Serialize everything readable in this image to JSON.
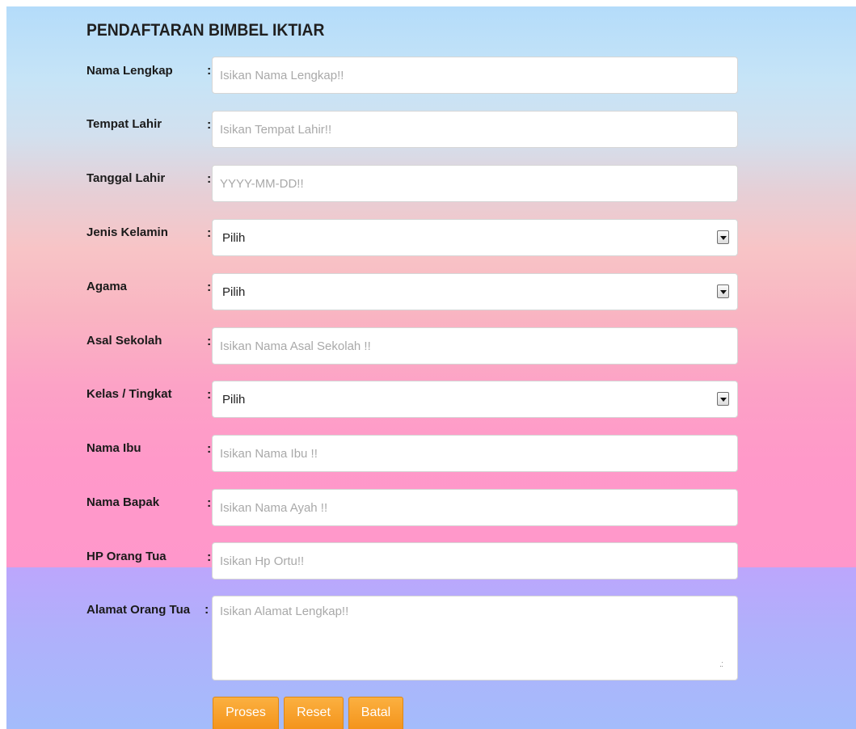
{
  "form": {
    "title": "PENDAFTARAN BIMBEL IKTIAR",
    "colon": ":",
    "fields": {
      "nama_lengkap": {
        "label": "Nama Lengkap",
        "placeholder": "Isikan Nama Lengkap!!",
        "value": ""
      },
      "tempat_lahir": {
        "label": "Tempat Lahir",
        "placeholder": "Isikan Tempat Lahir!!",
        "value": ""
      },
      "tanggal_lahir": {
        "label": "Tanggal Lahir",
        "placeholder": "YYYY-MM-DD!!",
        "value": ""
      },
      "jenis_kelamin": {
        "label": "Jenis Kelamin",
        "selected": "Pilih"
      },
      "agama": {
        "label": "Agama",
        "selected": "Pilih"
      },
      "asal_sekolah": {
        "label": "Asal Sekolah",
        "placeholder": "Isikan Nama Asal Sekolah !!",
        "value": ""
      },
      "kelas_tingkat": {
        "label": "Kelas / Tingkat",
        "selected": "Pilih"
      },
      "nama_ibu": {
        "label": "Nama Ibu",
        "placeholder": "Isikan Nama Ibu !!",
        "value": ""
      },
      "nama_bapak": {
        "label": "Nama Bapak",
        "placeholder": "Isikan Nama Ayah !!",
        "value": ""
      },
      "hp_orang_tua": {
        "label": "HP Orang Tua",
        "placeholder": "Isikan Hp Ortu!!",
        "value": ""
      },
      "alamat_orang_tua": {
        "label": "Alamat Orang Tua",
        "placeholder": "Isikan Alamat Lengkap!!",
        "value": ""
      }
    },
    "buttons": {
      "proses": "Proses",
      "reset": "Reset",
      "batal": "Batal"
    }
  },
  "colors": {
    "button_orange": "#f7a22b",
    "background_top": "#b4dcfa",
    "background_pink": "#ff99c9",
    "background_bottom": "#a4bcfb"
  },
  "icons": {
    "select_arrow": "chevron-down-icon",
    "textarea_grip": "resize-grip-icon"
  }
}
